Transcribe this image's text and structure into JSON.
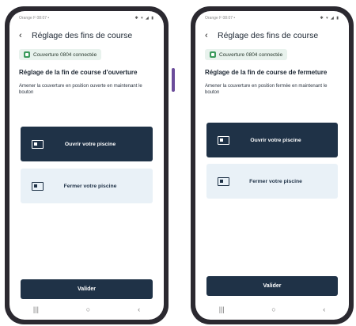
{
  "screens": [
    {
      "status_left": "Orange F  08:07  •",
      "status_right": "✱ ▾ ◢ ▮",
      "back_icon": "‹",
      "title": "Réglage des fins de course",
      "badge": "Couverture 0804 connectée",
      "heading": "Réglage de la fin de course d'ouverture",
      "description": "Amener la couverture en position ouverte en maintenant le bouton",
      "open_button": "Ouvrir votre piscine",
      "close_button": "Fermer votre piscine",
      "validate_button": "Valider",
      "nav": [
        "|||",
        "○",
        "‹"
      ]
    },
    {
      "status_left": "Orange F  08:07  •",
      "status_right": "✱ ▾ ◢ ▮",
      "back_icon": "‹",
      "title": "Réglage des fins de course",
      "badge": "Couverture 0804 connectée",
      "heading": "Réglage de la fin de course de fermeture",
      "description": "Amener la couverture en position fermée en maintenant le bouton",
      "open_button": "Ouvrir votre piscine",
      "close_button": "Fermer votre piscine",
      "validate_button": "Valider",
      "nav": [
        "|||",
        "○",
        "‹"
      ]
    }
  ],
  "colors": {
    "primary": "#1f3247",
    "secondary": "#e9f1f7",
    "badge_bg": "#e8f2ed",
    "badge_icon": "#3a9a5c",
    "phone_frame": "#2b2930"
  }
}
